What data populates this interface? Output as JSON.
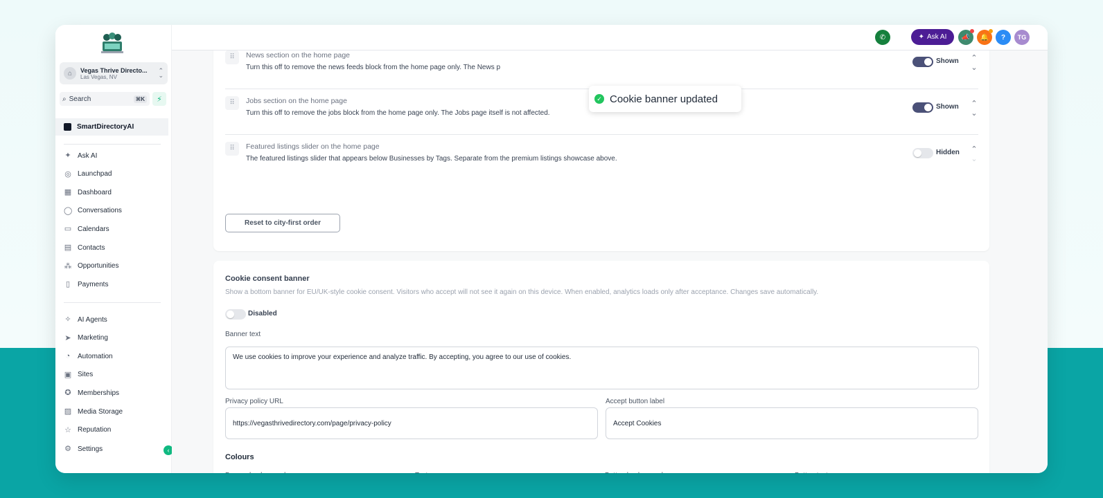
{
  "account": {
    "name": "Vegas Thrive Directo...",
    "city": "Las Vegas, NV"
  },
  "search": {
    "label": "Search",
    "shortcut": "⌘K"
  },
  "sidebar": {
    "brand": "SmartDirectoryAI",
    "group1": [
      {
        "label": "Ask AI",
        "icon": "sparkle-icon"
      },
      {
        "label": "Launchpad",
        "icon": "rocket-icon"
      },
      {
        "label": "Dashboard",
        "icon": "dashboard-icon"
      },
      {
        "label": "Conversations",
        "icon": "chat-icon"
      },
      {
        "label": "Calendars",
        "icon": "calendar-icon"
      },
      {
        "label": "Contacts",
        "icon": "contacts-icon"
      },
      {
        "label": "Opportunities",
        "icon": "opportunities-icon"
      },
      {
        "label": "Payments",
        "icon": "payments-icon"
      }
    ],
    "group2": [
      {
        "label": "AI Agents",
        "icon": "ai-agents-icon"
      },
      {
        "label": "Marketing",
        "icon": "send-icon"
      },
      {
        "label": "Automation",
        "icon": "automation-icon"
      },
      {
        "label": "Sites",
        "icon": "sites-icon"
      },
      {
        "label": "Memberships",
        "icon": "badge-icon"
      },
      {
        "label": "Media Storage",
        "icon": "image-icon"
      },
      {
        "label": "Reputation",
        "icon": "star-icon"
      }
    ],
    "settings": "Settings"
  },
  "topbar": {
    "ask_ai": "Ask AI",
    "help": "?",
    "user_initials": "TG"
  },
  "toast": {
    "message": "Cookie banner updated"
  },
  "sections": [
    {
      "title": "News section on the home page",
      "desc": "Turn this off to remove the news feeds block from the home page only. The News p",
      "state": "Shown",
      "on": true
    },
    {
      "title": "Jobs section on the home page",
      "desc": "Turn this off to remove the jobs block from the home page only. The Jobs page itself is not affected.",
      "state": "Shown",
      "on": true
    },
    {
      "title": "Featured listings slider on the home page",
      "desc": "The featured listings slider that appears below Businesses by Tags. Separate from the premium listings showcase above.",
      "state": "Hidden",
      "on": false
    }
  ],
  "reset_button": "Reset to city-first order",
  "cookie": {
    "title": "Cookie consent banner",
    "desc": "Show a bottom banner for EU/UK-style cookie consent. Visitors who accept will not see it again on this device. When enabled, analytics loads only after acceptance. Changes save automatically.",
    "state": "Disabled",
    "banner_text_label": "Banner text",
    "banner_text": "We use cookies to improve your experience and analyze traffic. By accepting, you agree to our use of cookies.",
    "privacy_label": "Privacy policy URL",
    "privacy_url": "https://vegasthrivedirectory.com/page/privacy-policy",
    "accept_label": "Accept button label",
    "accept_value": "Accept Cookies",
    "colours_heading": "Colours",
    "colours": [
      {
        "label": "Banner background",
        "color": "#1f2328"
      },
      {
        "label": "Text",
        "color": "#ffffff"
      },
      {
        "label": "Button background",
        "color": "#2f5bd7"
      },
      {
        "label": "Button text",
        "color": "#ffffff"
      }
    ]
  }
}
